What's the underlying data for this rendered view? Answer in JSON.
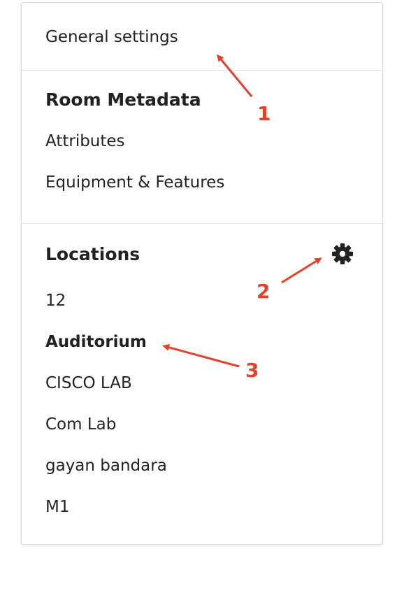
{
  "general": {
    "title": "General settings"
  },
  "room_metadata": {
    "heading": "Room Metadata",
    "items": [
      {
        "label": "Attributes"
      },
      {
        "label": "Equipment & Features"
      }
    ]
  },
  "locations": {
    "heading": "Locations",
    "settings_icon": "gear-icon",
    "selected": "Auditorium",
    "items": [
      {
        "label": "12"
      },
      {
        "label": "Auditorium"
      },
      {
        "label": "CISCO LAB"
      },
      {
        "label": "Com Lab"
      },
      {
        "label": "gayan bandara"
      },
      {
        "label": "M1"
      }
    ]
  },
  "annotations": {
    "color": "#e2412b",
    "markers": [
      {
        "label": "1"
      },
      {
        "label": "2"
      },
      {
        "label": "3"
      }
    ]
  }
}
